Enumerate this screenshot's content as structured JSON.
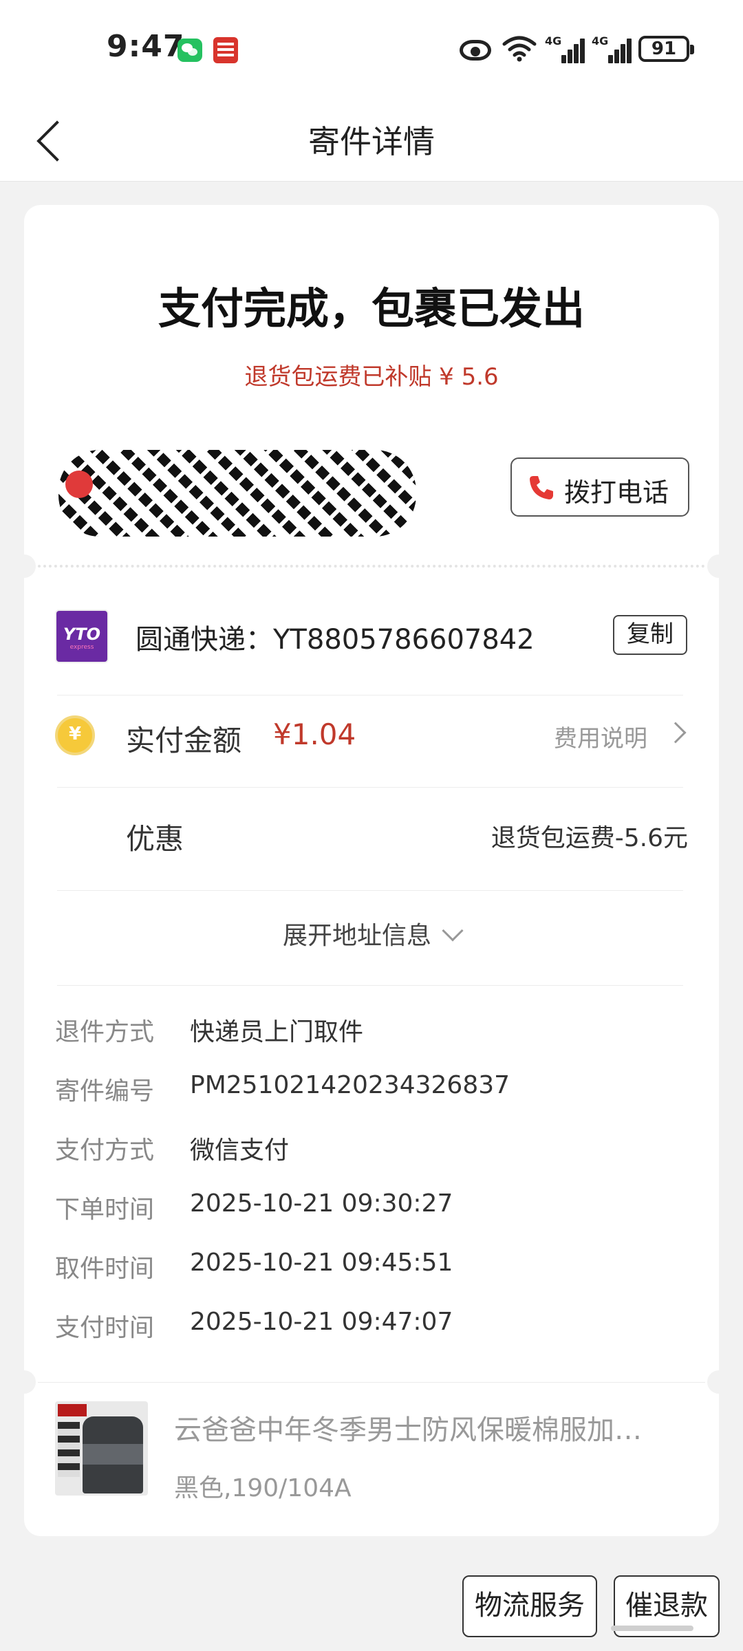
{
  "status_bar": {
    "time": "9:47",
    "network_1": "4G",
    "network_2": "4G",
    "battery": "91"
  },
  "header": {
    "title": "寄件详情"
  },
  "summary": {
    "title": "支付完成，包裹已发出",
    "subsidy_text": "退货包运费已补贴 ¥ 5.6",
    "call_button": "拨打电话"
  },
  "courier": {
    "logo_text": "YTO",
    "logo_sub": "express",
    "name_and_number": "圆通快递：YT8805786607842",
    "copy_button": "复制"
  },
  "payment": {
    "paid_label": "实付金额",
    "paid_amount": "¥1.04",
    "fee_link": "费用说明",
    "coin_symbol": "¥"
  },
  "discount": {
    "label": "优惠",
    "value": "退货包运费-5.6元"
  },
  "expand": {
    "label": "展开地址信息"
  },
  "details": [
    {
      "key": "退件方式",
      "value": "快递员上门取件"
    },
    {
      "key": "寄件编号",
      "value": "PM251021420234326837"
    },
    {
      "key": "支付方式",
      "value": "微信支付"
    },
    {
      "key": "下单时间",
      "value": "2025-10-21 09:30:27"
    },
    {
      "key": "取件时间",
      "value": "2025-10-21 09:45:51"
    },
    {
      "key": "支付时间",
      "value": "2025-10-21 09:47:07"
    }
  ],
  "product": {
    "title": "云爸爸中年冬季男士防风保暖棉服加…",
    "variant": "黑色,190/104A"
  },
  "bottom_actions": {
    "logistics": "物流服务",
    "urge_refund": "催退款"
  },
  "colors": {
    "accent_red": "#c0392b",
    "brand_purple": "#6a2aa3",
    "coin_gold": "#f6c93a",
    "wechat_green": "#25c160"
  }
}
